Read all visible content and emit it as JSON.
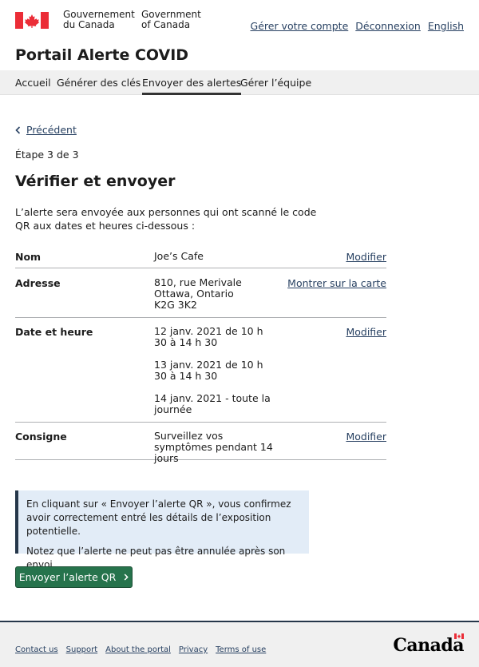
{
  "header": {
    "gov_fr_line1": "Gouvernement",
    "gov_fr_line2": "du Canada",
    "gov_en_line1": "Government",
    "gov_en_line2": "of Canada",
    "links": [
      "Gérer votre compte",
      "Déconnexion",
      "English"
    ]
  },
  "app_title": "Portail Alerte COVID",
  "nav": {
    "items": [
      "Accueil",
      "Générer des clés",
      "Envoyer des alertes",
      "Gérer l’équipe"
    ],
    "active": "Envoyer des alertes"
  },
  "back_label": "Précédent",
  "step": "Étape 3 de 3",
  "heading": "Vérifier et envoyer",
  "intro": "L’alerte sera envoyée aux personnes qui ont scanné le code QR aux dates et heures ci-dessous :",
  "summary": {
    "name": {
      "key": "Nom",
      "value": "Joe’s Cafe",
      "action": "Modifier"
    },
    "address": {
      "key": "Adresse",
      "line1": "810, rue Merivale",
      "line2": "Ottawa, Ontario",
      "line3": "K2G 3K2",
      "action": "Montrer sur la carte"
    },
    "datetime": {
      "key": "Date et heure",
      "entries": [
        "12 janv. 2021 de 10 h 30 à 14 h 30",
        "13 janv. 2021 de 10 h 30 à 14 h 30",
        "14 janv. 2021 - toute la journée"
      ],
      "action": "Modifier"
    },
    "instruction": {
      "key": "Consigne",
      "value": "Surveillez vos symptômes pendant 14 jours",
      "action": "Modifier"
    }
  },
  "notice": {
    "p1": "En cliquant sur « Envoyer l’alerte QR », vous confirmez avoir correctement entré les détails de l’exposition potentielle.",
    "p2": "Notez que l’alerte ne peut pas être annulée après son envoi."
  },
  "send_button": "Envoyer l’alerte QR",
  "footer": {
    "links": [
      "Contact us",
      "Support",
      "About the portal",
      "Privacy",
      "Terms of use"
    ],
    "wordmark": "Canada"
  },
  "colors": {
    "link": "#284162",
    "button": "#26734c",
    "notice_bg": "#e2ecf7",
    "flag_red": "#eb2d37"
  }
}
